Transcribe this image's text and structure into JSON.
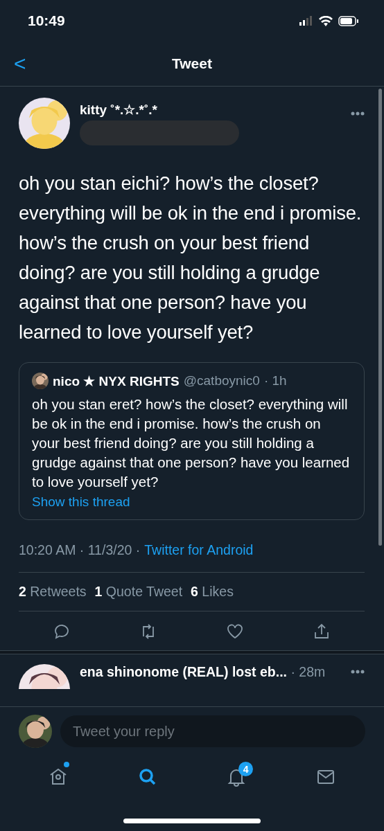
{
  "status_bar": {
    "time": "10:49"
  },
  "header": {
    "back": "<",
    "title": "Tweet"
  },
  "tweet": {
    "author": "kitty ˚*.☆.*˚.*",
    "handle_redacted": true,
    "text": "oh you stan eichi? how’s the closet? everything will be ok in the end i promise. how’s the crush on your best friend doing? are you still holding a grudge against that one person? have you learned to love yourself yet?",
    "quote": {
      "name": "nico ★ NYX RIGHTS",
      "handle": "@catboynic0",
      "time": "· 1h",
      "text": "oh you stan eret? how’s the closet? everything will be ok in the end i promise. how’s the crush on your best friend doing? are you still holding a grudge against that one person? have you learned to love yourself yet?",
      "link": "Show this thread"
    },
    "timestamp": "10:20 AM · 11/3/20 ·",
    "source": "Twitter for Android",
    "stats": [
      {
        "count": "2",
        "label": "Retweets"
      },
      {
        "count": "1",
        "label": "Quote Tweet"
      },
      {
        "count": "6",
        "label": "Likes"
      }
    ],
    "actions": [
      {
        "kind": "reply"
      },
      {
        "kind": "retweet"
      },
      {
        "kind": "like"
      },
      {
        "kind": "share"
      }
    ]
  },
  "reply": {
    "name": "ena shinonome (REAL) lost eb...",
    "time": "· 28m"
  },
  "composer": {
    "placeholder": "Tweet your reply"
  },
  "tabs": [
    {
      "kind": "home",
      "selected": false,
      "dot": true
    },
    {
      "kind": "search",
      "selected": true
    },
    {
      "kind": "notifications",
      "selected": false,
      "badge": "4"
    },
    {
      "kind": "messages",
      "selected": false
    }
  ]
}
